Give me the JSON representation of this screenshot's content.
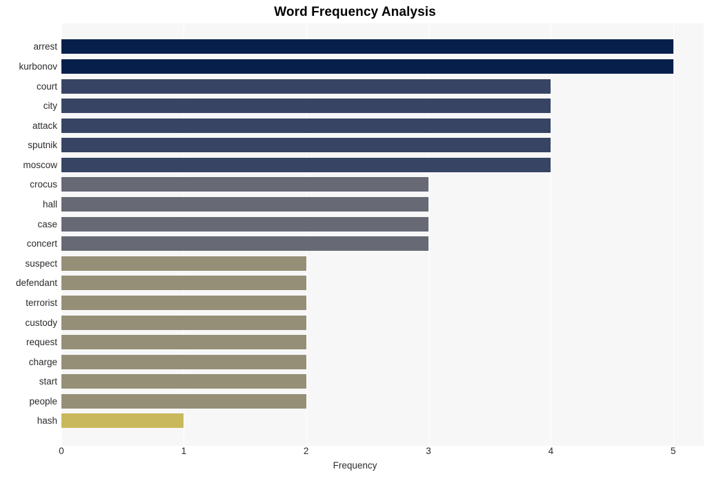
{
  "chart_data": {
    "type": "bar",
    "orientation": "horizontal",
    "title": "Word Frequency Analysis",
    "xlabel": "Frequency",
    "ylabel": "",
    "xlim": [
      0,
      5.25
    ],
    "xticks": [
      0,
      1,
      2,
      3,
      4,
      5
    ],
    "xtick_labels": [
      "0",
      "1",
      "2",
      "3",
      "4",
      "5"
    ],
    "grid": "vertical-white",
    "legend": "none",
    "categories": [
      "arrest",
      "kurbonov",
      "court",
      "city",
      "attack",
      "sputnik",
      "moscow",
      "crocus",
      "hall",
      "case",
      "concert",
      "suspect",
      "defendant",
      "terrorist",
      "custody",
      "request",
      "charge",
      "start",
      "people",
      "hash"
    ],
    "values": [
      5,
      5,
      4,
      4,
      4,
      4,
      4,
      3,
      3,
      3,
      3,
      2,
      2,
      2,
      2,
      2,
      2,
      2,
      2,
      1
    ],
    "bar_colors": [
      "#06204b",
      "#06204b",
      "#374463",
      "#374463",
      "#374463",
      "#374463",
      "#374463",
      "#676a74",
      "#676a74",
      "#676a74",
      "#676a74",
      "#958f78",
      "#958f78",
      "#958f78",
      "#958f78",
      "#958f78",
      "#958f78",
      "#958f78",
      "#958f78",
      "#c9b85c"
    ],
    "plot_background": "#f7f7f7",
    "gridline_color": "#ffffff",
    "title_color": "#000000",
    "tick_label_color": "#2b2b2b"
  }
}
